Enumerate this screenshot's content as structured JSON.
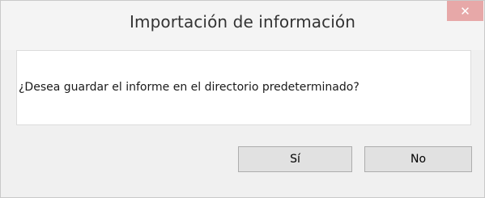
{
  "window": {
    "title": "Importación de información",
    "close_glyph": "✕"
  },
  "message": "¿Desea guardar el informe en el directorio predeterminado?",
  "buttons": {
    "yes_label": "Sí",
    "no_label": "No"
  },
  "colors": {
    "close_button": "#e7a8a8",
    "dialog_background": "#f0f0f0",
    "content_background": "#ffffff"
  }
}
